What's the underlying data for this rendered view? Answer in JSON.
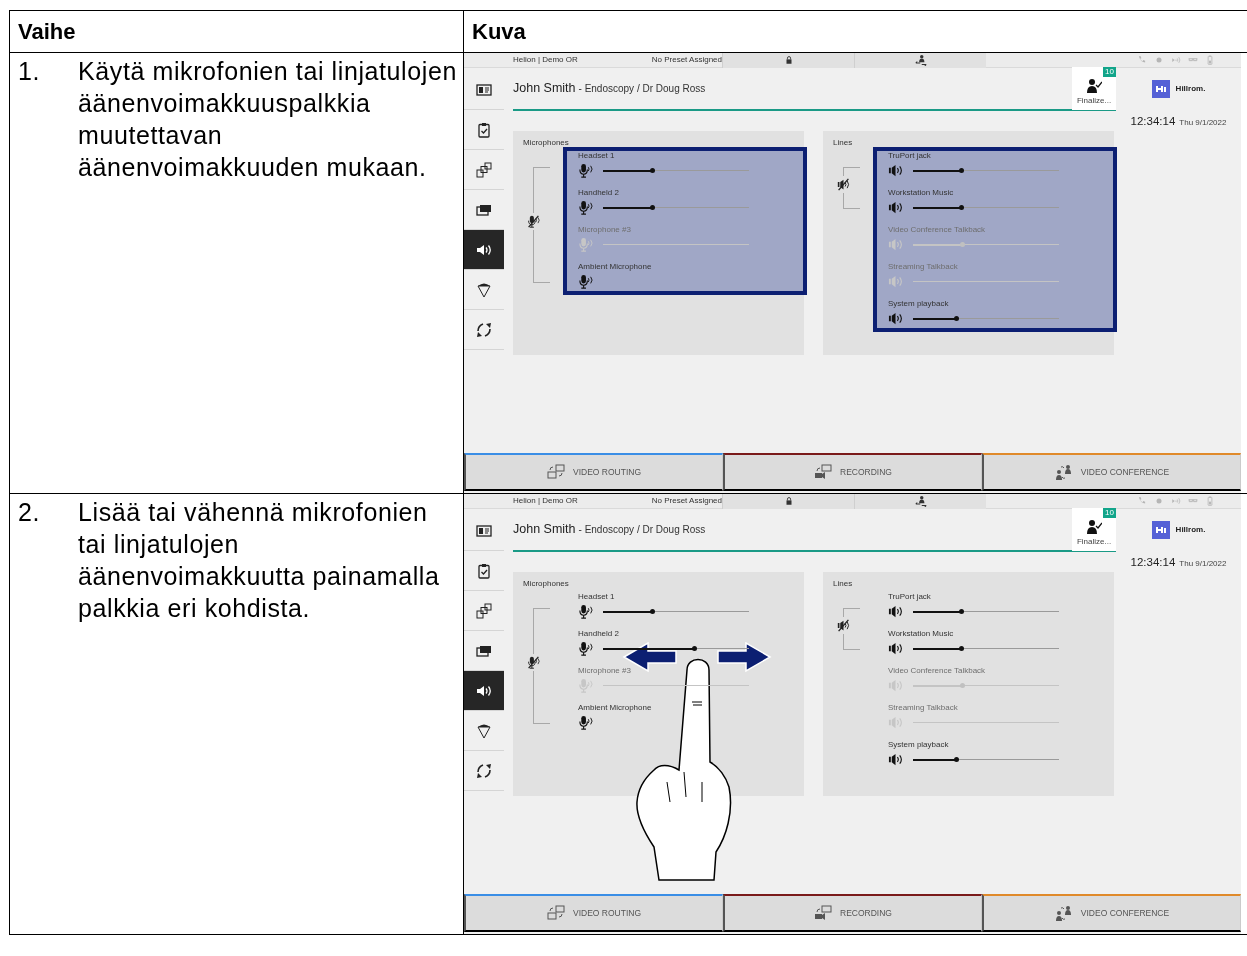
{
  "table": {
    "columns": [
      "Vaihe",
      "Kuva"
    ],
    "rows": [
      {
        "step": "1.",
        "text": "Käytä mikrofonien tai linjatulojen äänenvoimakkuuspalkkia muutettavan äänenvoimakkuuden mukaan.",
        "screen": {
          "location": "Helion | Demo OR",
          "preset": "No Preset Assigned",
          "patient": "John Smith",
          "procedure": "- Endoscopy / Dr Doug Ross",
          "finalize": {
            "label": "Finalize...",
            "badge": "10"
          },
          "logo": "Hillrom.",
          "time": "12:34:14",
          "date": "Thu 9/1/2022",
          "swipe": false,
          "sidebar": [
            {
              "kind": "patient",
              "selected": false
            },
            {
              "kind": "checklist",
              "selected": false
            },
            {
              "kind": "layout",
              "selected": false
            },
            {
              "kind": "displays",
              "selected": false
            },
            {
              "kind": "audio",
              "selected": true
            },
            {
              "kind": "lighting",
              "selected": false
            },
            {
              "kind": "expand",
              "selected": false
            }
          ],
          "panels": [
            {
              "title": "Microphones",
              "kind": "mic",
              "highlighted": true,
              "channels": [
                {
                  "name": "Headset 1",
                  "kind": "slider",
                  "disabled": false,
                  "grouped": true,
                  "level": 0.34
                },
                {
                  "name": "Handheld 2",
                  "kind": "slider",
                  "disabled": false,
                  "grouped": true,
                  "level": 0.34
                },
                {
                  "name": "Microphone #3",
                  "kind": "slider",
                  "disabled": true,
                  "grouped": true
                },
                {
                  "name": "Ambient Microphone",
                  "kind": "icon",
                  "disabled": false,
                  "grouped": true
                }
              ]
            },
            {
              "title": "Lines",
              "kind": "line",
              "highlighted": true,
              "channels": [
                {
                  "name": "TruPort jack",
                  "kind": "slider",
                  "disabled": false,
                  "grouped": true,
                  "level": 0.33
                },
                {
                  "name": "Workstation Music",
                  "kind": "slider",
                  "disabled": false,
                  "grouped": true,
                  "level": 0.33
                },
                {
                  "name": "Video Conference Talkback",
                  "kind": "slider",
                  "disabled": true,
                  "grouped": false,
                  "level": 0.34
                },
                {
                  "name": "Streaming Talkback",
                  "kind": "slider",
                  "disabled": true,
                  "grouped": false
                },
                {
                  "name": "System playback",
                  "kind": "slider",
                  "disabled": false,
                  "grouped": false,
                  "level": 0.3
                }
              ]
            }
          ],
          "tabs": [
            {
              "label": "VIDEO ROUTING",
              "kind": "routing",
              "color": "#3a8ee6"
            },
            {
              "label": "RECORDING",
              "kind": "recording",
              "color": "#7a1a1a"
            },
            {
              "label": "VIDEO CONFERENCE",
              "kind": "conference",
              "color": "#e08a2a"
            }
          ]
        }
      },
      {
        "step": "2.",
        "text": "Lisää tai vähennä mikrofonien tai linjatulojen äänenvoimakkuutta painamalla palkkia eri kohdista.",
        "screen": {
          "location": "Helion | Demo OR",
          "preset": "No Preset Assigned",
          "patient": "John Smith",
          "procedure": "- Endoscopy / Dr Doug Ross",
          "finalize": {
            "label": "Finalize...",
            "badge": "10"
          },
          "logo": "Hillrom.",
          "time": "12:34:14",
          "date": "Thu 9/1/2022",
          "swipe": true,
          "sidebar": [
            {
              "kind": "patient",
              "selected": false
            },
            {
              "kind": "checklist",
              "selected": false
            },
            {
              "kind": "layout",
              "selected": false
            },
            {
              "kind": "displays",
              "selected": false
            },
            {
              "kind": "audio",
              "selected": true
            },
            {
              "kind": "lighting",
              "selected": false
            },
            {
              "kind": "expand",
              "selected": false
            }
          ],
          "panels": [
            {
              "title": "Microphones",
              "kind": "mic",
              "highlighted": false,
              "channels": [
                {
                  "name": "Headset 1",
                  "kind": "slider",
                  "disabled": false,
                  "grouped": true,
                  "level": 0.34
                },
                {
                  "name": "Handheld 2",
                  "kind": "slider",
                  "disabled": false,
                  "grouped": true,
                  "level": 0.63
                },
                {
                  "name": "Microphone #3",
                  "kind": "slider",
                  "disabled": true,
                  "grouped": true
                },
                {
                  "name": "Ambient Microphone",
                  "kind": "icon",
                  "disabled": false,
                  "grouped": true
                }
              ]
            },
            {
              "title": "Lines",
              "kind": "line",
              "highlighted": false,
              "channels": [
                {
                  "name": "TruPort jack",
                  "kind": "slider",
                  "disabled": false,
                  "grouped": true,
                  "level": 0.33
                },
                {
                  "name": "Workstation Music",
                  "kind": "slider",
                  "disabled": false,
                  "grouped": true,
                  "level": 0.33
                },
                {
                  "name": "Video Conference Talkback",
                  "kind": "slider",
                  "disabled": true,
                  "grouped": false,
                  "level": 0.34
                },
                {
                  "name": "Streaming Talkback",
                  "kind": "slider",
                  "disabled": true,
                  "grouped": false
                },
                {
                  "name": "System playback",
                  "kind": "slider",
                  "disabled": false,
                  "grouped": false,
                  "level": 0.3
                }
              ]
            }
          ],
          "tabs": [
            {
              "label": "VIDEO ROUTING",
              "kind": "routing",
              "color": "#3a8ee6"
            },
            {
              "label": "RECORDING",
              "kind": "recording",
              "color": "#7a1a1a"
            },
            {
              "label": "VIDEO CONFERENCE",
              "kind": "conference",
              "color": "#e08a2a"
            }
          ]
        }
      }
    ]
  }
}
